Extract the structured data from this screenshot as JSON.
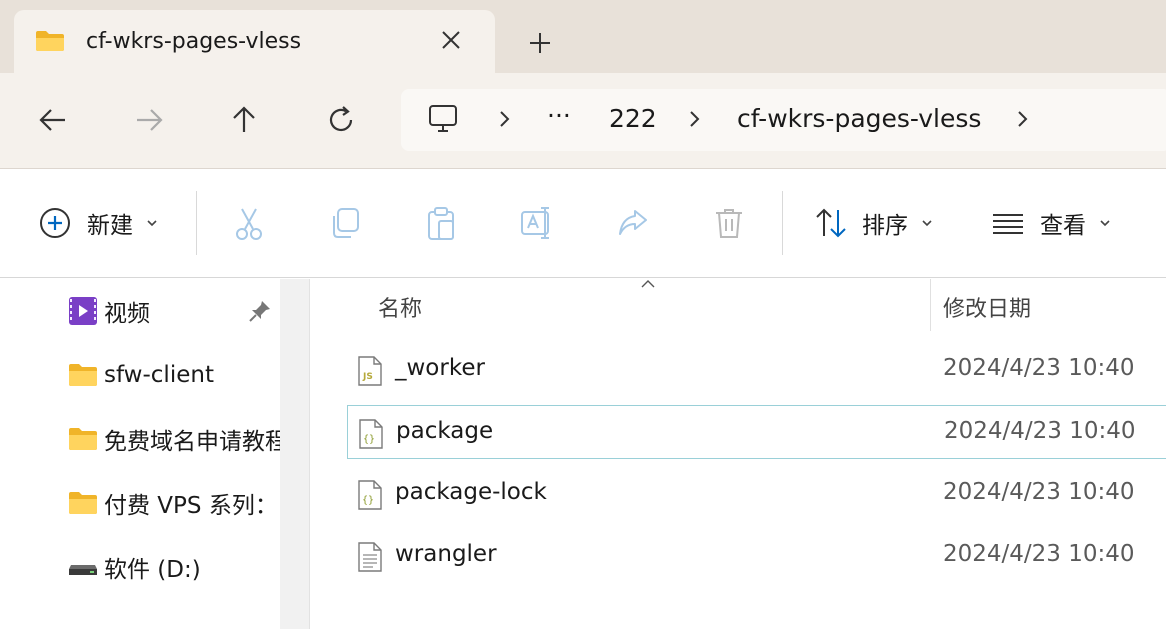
{
  "tab": {
    "title": "cf-wkrs-pages-vless",
    "close_icon": "close-icon",
    "new_tab_icon": "plus-icon"
  },
  "nav": {
    "back_icon": "arrow-left-icon",
    "forward_icon": "arrow-right-icon",
    "up_icon": "arrow-up-icon",
    "refresh_icon": "refresh-icon"
  },
  "address": {
    "root_icon": "monitor-icon",
    "overflow": "···",
    "segments": [
      "222",
      "cf-wkrs-pages-vless"
    ]
  },
  "toolbar": {
    "new_label": "新建",
    "sort_label": "排序",
    "view_label": "查看",
    "icons": [
      "cut-icon",
      "copy-icon",
      "paste-icon",
      "rename-icon",
      "share-icon",
      "delete-icon"
    ]
  },
  "sidebar": {
    "items": [
      {
        "label": "视频",
        "icon": "video-icon",
        "pinned": true
      },
      {
        "label": "sfw-client",
        "icon": "folder-icon"
      },
      {
        "label": "免费域名申请教程",
        "icon": "folder-icon"
      },
      {
        "label": "付费 VPS 系列：",
        "icon": "folder-icon"
      },
      {
        "label": "软件 (D:)",
        "icon": "drive-icon"
      }
    ]
  },
  "files": {
    "columns": {
      "name": "名称",
      "date": "修改日期"
    },
    "rows": [
      {
        "name": "_worker",
        "date": "2024/4/23 10:40",
        "icon": "js-file-icon"
      },
      {
        "name": "package",
        "date": "2024/4/23 10:40",
        "icon": "json-file-icon",
        "selected": true
      },
      {
        "name": "package-lock",
        "date": "2024/4/23 10:40",
        "icon": "json-file-icon"
      },
      {
        "name": "wrangler",
        "date": "2024/4/23 10:40",
        "icon": "text-file-icon"
      }
    ]
  },
  "colors": {
    "accent": "#0067c0",
    "folder": "#f4c542",
    "selection_border": "#9ad0d8"
  }
}
